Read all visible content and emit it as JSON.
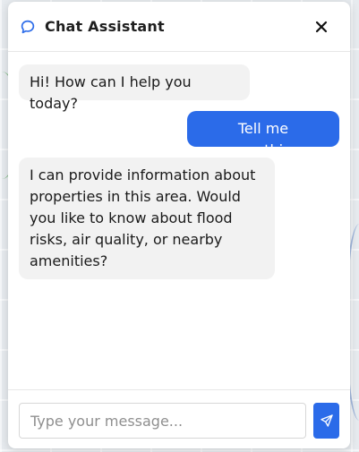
{
  "header": {
    "title": "Chat Assistant",
    "icon": "chat-bubble-icon",
    "close_icon": "close-icon"
  },
  "messages": [
    {
      "role": "assistant",
      "text": "Hi! How can I help you today?"
    },
    {
      "role": "user",
      "text": "Tell me something"
    },
    {
      "role": "assistant",
      "lines": [
        "I can provide information about",
        "properties in this area. Would",
        "you like to know about flood",
        "risks, air quality, or nearby",
        "amenities?"
      ]
    }
  ],
  "composer": {
    "placeholder": "Type your message...",
    "value": "",
    "send_icon": "send-icon"
  },
  "colors": {
    "accent": "#2b6be9",
    "assistant_bubble": "#f2f2f2",
    "panel_bg": "#ffffff"
  }
}
